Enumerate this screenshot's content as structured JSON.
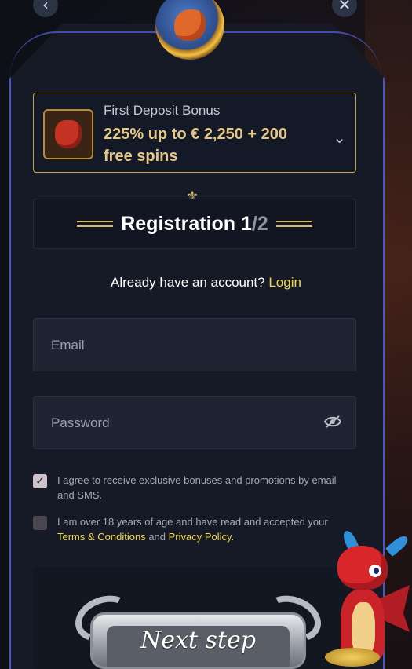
{
  "nav": {
    "back_icon": "chevron-left-icon",
    "close_icon": "close-icon"
  },
  "bonus": {
    "title": "First Deposit Bonus",
    "amount": "225% up to € 2,250 + 200 free spins",
    "icon": "money-bag-icon",
    "chevron": "chevron-down-icon"
  },
  "registration": {
    "title": "Registration 1",
    "step_sep": "/",
    "step_total": "2"
  },
  "account": {
    "prompt": "Already have an account? ",
    "login_label": "Login"
  },
  "form": {
    "email_placeholder": "Email",
    "email_value": "",
    "password_placeholder": "Password",
    "password_value": "",
    "password_toggle_icon": "eye-off-icon"
  },
  "consents": [
    {
      "checked": true,
      "text": "I agree to receive exclusive bonuses and promotions by email and SMS."
    },
    {
      "checked": false,
      "text_before": "I am over 18 years of age and have read and accepted your ",
      "terms_label": "Terms & Conditions",
      "and": " and ",
      "privacy_label": "Privacy Policy."
    }
  ],
  "cta": {
    "next_label": "Next step"
  },
  "colors": {
    "accent": "#f1d64a",
    "gold": "#e6c884",
    "panel": "#151a26",
    "border": "#4a55c8"
  }
}
